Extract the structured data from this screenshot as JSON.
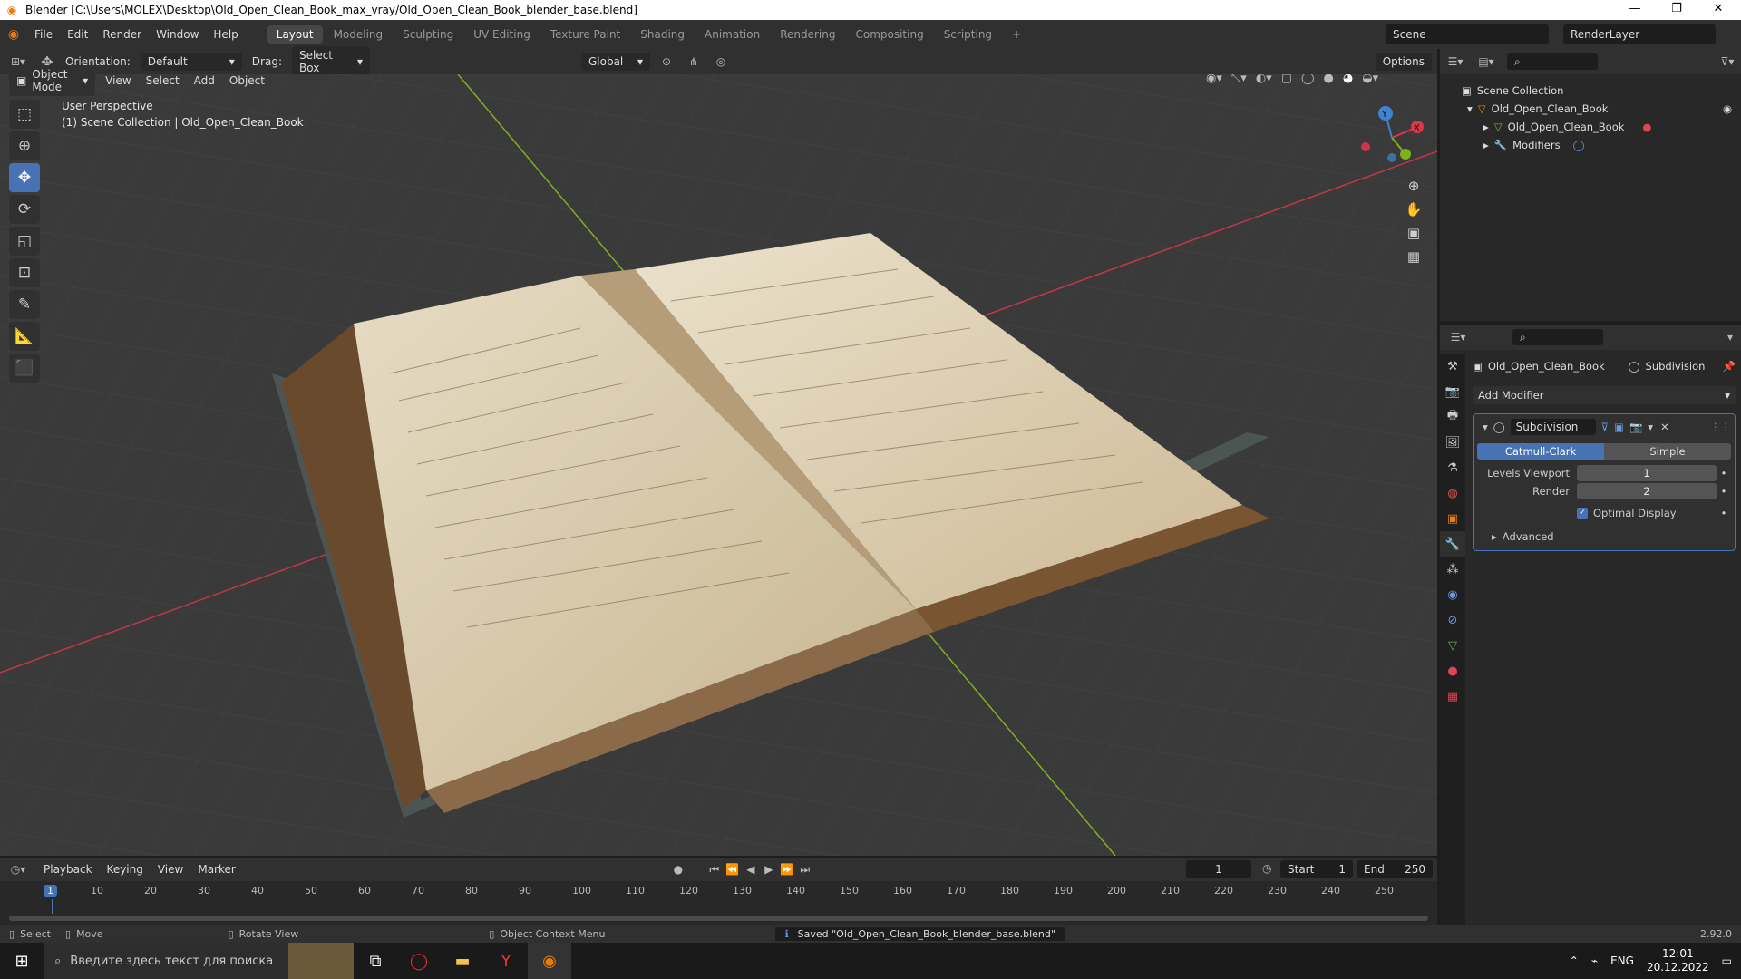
{
  "window": {
    "title": "Blender [C:\\Users\\MOLEX\\Desktop\\Old_Open_Clean_Book_max_vray/Old_Open_Clean_Book_blender_base.blend]",
    "minimize": "—",
    "restore": "❐",
    "close": "✕"
  },
  "menu": {
    "items": [
      "File",
      "Edit",
      "Render",
      "Window",
      "Help"
    ]
  },
  "workspaces": {
    "tabs": [
      "Layout",
      "Modeling",
      "Sculpting",
      "UV Editing",
      "Texture Paint",
      "Shading",
      "Animation",
      "Rendering",
      "Compositing",
      "Scripting"
    ],
    "active": "Layout",
    "add": "+"
  },
  "scene": {
    "name": "Scene",
    "view_layer": "RenderLayer"
  },
  "tool_header": {
    "orientation_label": "Orientation:",
    "orientation_value": "Default",
    "drag_label": "Drag:",
    "drag_value": "Select Box",
    "transform_orientation": "Global",
    "options": "Options"
  },
  "viewport_header": {
    "mode": "Object Mode",
    "menus": [
      "View",
      "Select",
      "Add",
      "Object"
    ]
  },
  "viewport": {
    "perspective": "User Perspective",
    "collection_info": "(1) Scene Collection | Old_Open_Clean_Book",
    "gizmo": {
      "x": "X",
      "y": "Y",
      "z": "Z"
    }
  },
  "outliner": {
    "root": "Scene Collection",
    "object": "Old_Open_Clean_Book",
    "mesh": "Old_Open_Clean_Book",
    "modifiers": "Modifiers"
  },
  "properties": {
    "breadcrumb_object": "Old_Open_Clean_Book",
    "breadcrumb_modifier": "Subdivision",
    "add_modifier": "Add Modifier",
    "modifier_name": "Subdivision",
    "method_catmull": "Catmull-Clark",
    "method_simple": "Simple",
    "levels_viewport_label": "Levels Viewport",
    "levels_viewport_value": "1",
    "render_label": "Render",
    "render_value": "2",
    "optimal_display": "Optimal Display",
    "advanced": "Advanced"
  },
  "timeline": {
    "menus": [
      "Playback",
      "Keying",
      "View",
      "Marker"
    ],
    "current_frame": "1",
    "start_label": "Start",
    "start_value": "1",
    "end_label": "End",
    "end_value": "250",
    "ticks": [
      "1",
      "10",
      "20",
      "30",
      "40",
      "50",
      "60",
      "70",
      "80",
      "90",
      "100",
      "110",
      "120",
      "130",
      "140",
      "150",
      "160",
      "170",
      "180",
      "190",
      "200",
      "210",
      "220",
      "230",
      "240",
      "250"
    ]
  },
  "statusbar": {
    "select": "Select",
    "move": "Move",
    "rotate": "Rotate View",
    "context": "Object Context Menu",
    "message": "Saved \"Old_Open_Clean_Book_blender_base.blend\"",
    "version": "2.92.0"
  },
  "taskbar": {
    "search_placeholder": "Введите здесь текст для поиска",
    "lang": "ENG",
    "time": "12:01",
    "date": "20.12.2022"
  },
  "colors": {
    "accent": "#4772b3",
    "x_axis": "#e0354a",
    "y_axis": "#7fb01e",
    "z_axis": "#3f84d1",
    "blender_orange": "#e87d0d"
  }
}
